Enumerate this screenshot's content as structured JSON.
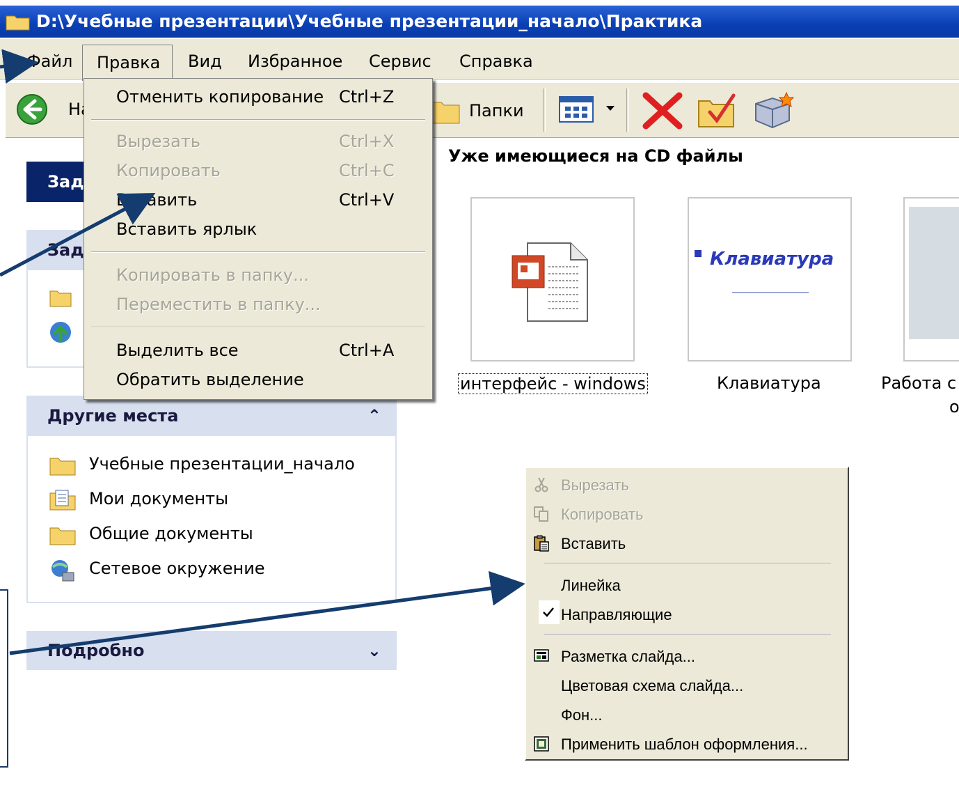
{
  "window": {
    "title": "D:\\Учебные презентации\\Учебные  презентации_начало\\Практика"
  },
  "menubar": {
    "items": [
      "Файл",
      "Правка",
      "Вид",
      "Избранное",
      "Сервис",
      "Справка"
    ]
  },
  "toolbar": {
    "back_label": "На",
    "folders_label": "Папки"
  },
  "edit_menu": {
    "undo": {
      "label": "Отменить копирование",
      "shortcut": "Ctrl+Z"
    },
    "cut": {
      "label": "Вырезать",
      "shortcut": "Ctrl+X"
    },
    "copy": {
      "label": "Копировать",
      "shortcut": "Ctrl+C"
    },
    "paste": {
      "label": "Вставить",
      "shortcut": "Ctrl+V"
    },
    "paste_shortcut": {
      "label": "Вставить ярлык"
    },
    "copy_to_folder": {
      "label": "Копировать в папку..."
    },
    "move_to_folder": {
      "label": "Переместить в папку..."
    },
    "select_all": {
      "label": "Выделить все",
      "shortcut": "Ctrl+A"
    },
    "invert_selection": {
      "label": "Обратить выделение"
    }
  },
  "left_pane": {
    "tasks_head_1": "Зад",
    "tasks_head_2": "Зад",
    "other_places": {
      "title": "Другие места",
      "items": [
        "Учебные  презентации_начало",
        "Мои документы",
        "Общие документы",
        "Сетевое окружение"
      ]
    },
    "details": {
      "title": "Подробно"
    }
  },
  "main": {
    "section_title": "Уже имеющиеся на CD файлы",
    "files": [
      {
        "name": "интерфейс - windows"
      },
      {
        "name": "Клавиатура",
        "thumb_title": "Клавиатура"
      },
      {
        "name": "Работа с",
        "name_line2": "о"
      }
    ]
  },
  "context_menu": {
    "items": [
      {
        "label": "Вырезать",
        "icon": "scissors-icon",
        "disabled": true
      },
      {
        "label": "Копировать",
        "icon": "copy-icon",
        "disabled": true
      },
      {
        "label": "Вставить",
        "icon": "paste-icon",
        "disabled": false
      },
      {
        "label": "Линейка",
        "disabled": false
      },
      {
        "label": "Направляющие",
        "checked": true,
        "disabled": false
      },
      {
        "label": "Разметка слайда...",
        "icon": "slide-layout-icon",
        "disabled": false
      },
      {
        "label": "Цветовая схема слайда...",
        "disabled": false
      },
      {
        "label": "Фон...",
        "disabled": false
      },
      {
        "label": "Применить шаблон оформления...",
        "icon": "template-icon",
        "disabled": false
      }
    ]
  },
  "colors": {
    "titlebar": "#0a3fb4",
    "menu_bg": "#ece9d8",
    "panel_head": "#d8dfef",
    "arrow": "#143c6e"
  }
}
